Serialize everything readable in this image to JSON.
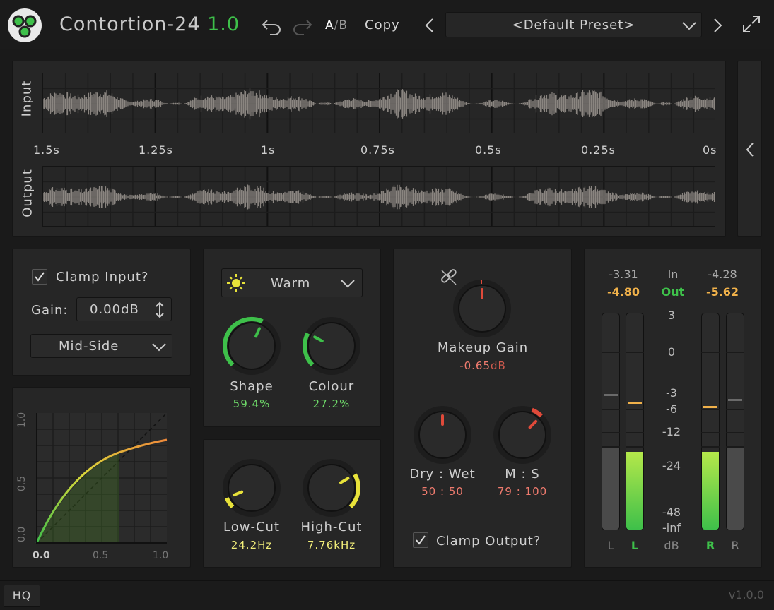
{
  "app": {
    "name": "Contortion-24",
    "version_badge": "1.0",
    "ab_a": "A",
    "ab_b": "B",
    "copy": "Copy",
    "preset": "<Default Preset>",
    "footer_version": "v1.0.0",
    "hq": "HQ"
  },
  "scope": {
    "input_label": "Input",
    "output_label": "Output",
    "time_ticks": [
      "1.5s",
      "1.25s",
      "1s",
      "0.75s",
      "0.5s",
      "0.25s",
      "0s"
    ]
  },
  "clamp_input": {
    "label": "Clamp Input?",
    "checked": true,
    "gain_label": "Gain:",
    "gain_value": "0.00dB",
    "mode": "Mid-Side"
  },
  "curve": {
    "y_ticks": [
      "1.0",
      "0.5",
      "0.0"
    ],
    "x_ticks": [
      "0.0",
      "0.5",
      "1.0"
    ]
  },
  "tone": {
    "mode": "Warm",
    "shape_label": "Shape",
    "shape_value": "59.4%",
    "shape_fraction": 0.594,
    "colour_label": "Colour",
    "colour_value": "27.2%",
    "colour_fraction": 0.272
  },
  "filters": {
    "lowcut_label": "Low-Cut",
    "lowcut_value": "24.2Hz",
    "highcut_label": "High-Cut",
    "highcut_value": "7.76kHz"
  },
  "output": {
    "makeup_label": "Makeup Gain",
    "makeup_value": "-0.65",
    "makeup_unit": "dB",
    "drywet_label": "Dry : Wet",
    "drywet_value": "50 : 50",
    "ms_label": "M : S",
    "ms_value": "79 : 100",
    "clamp_label": "Clamp Output?",
    "clamp_checked": true
  },
  "meters": {
    "in_left": "-3.31",
    "in_label": "In",
    "in_right": "-4.28",
    "out_left": "-4.80",
    "out_label": "Out",
    "out_right": "-5.62",
    "scale": [
      "3",
      "0",
      "-3",
      "-6",
      "-12",
      "-24",
      "-48",
      "-inf",
      "dB"
    ],
    "ch_labels": [
      "L",
      "L",
      "R",
      "R"
    ]
  },
  "colors": {
    "accent_green": "#3ec04a",
    "accent_yellow": "#e8e23a",
    "accent_red": "#e04a3a",
    "value_orange": "#f0b14a",
    "value_red": "#f07b6e"
  }
}
